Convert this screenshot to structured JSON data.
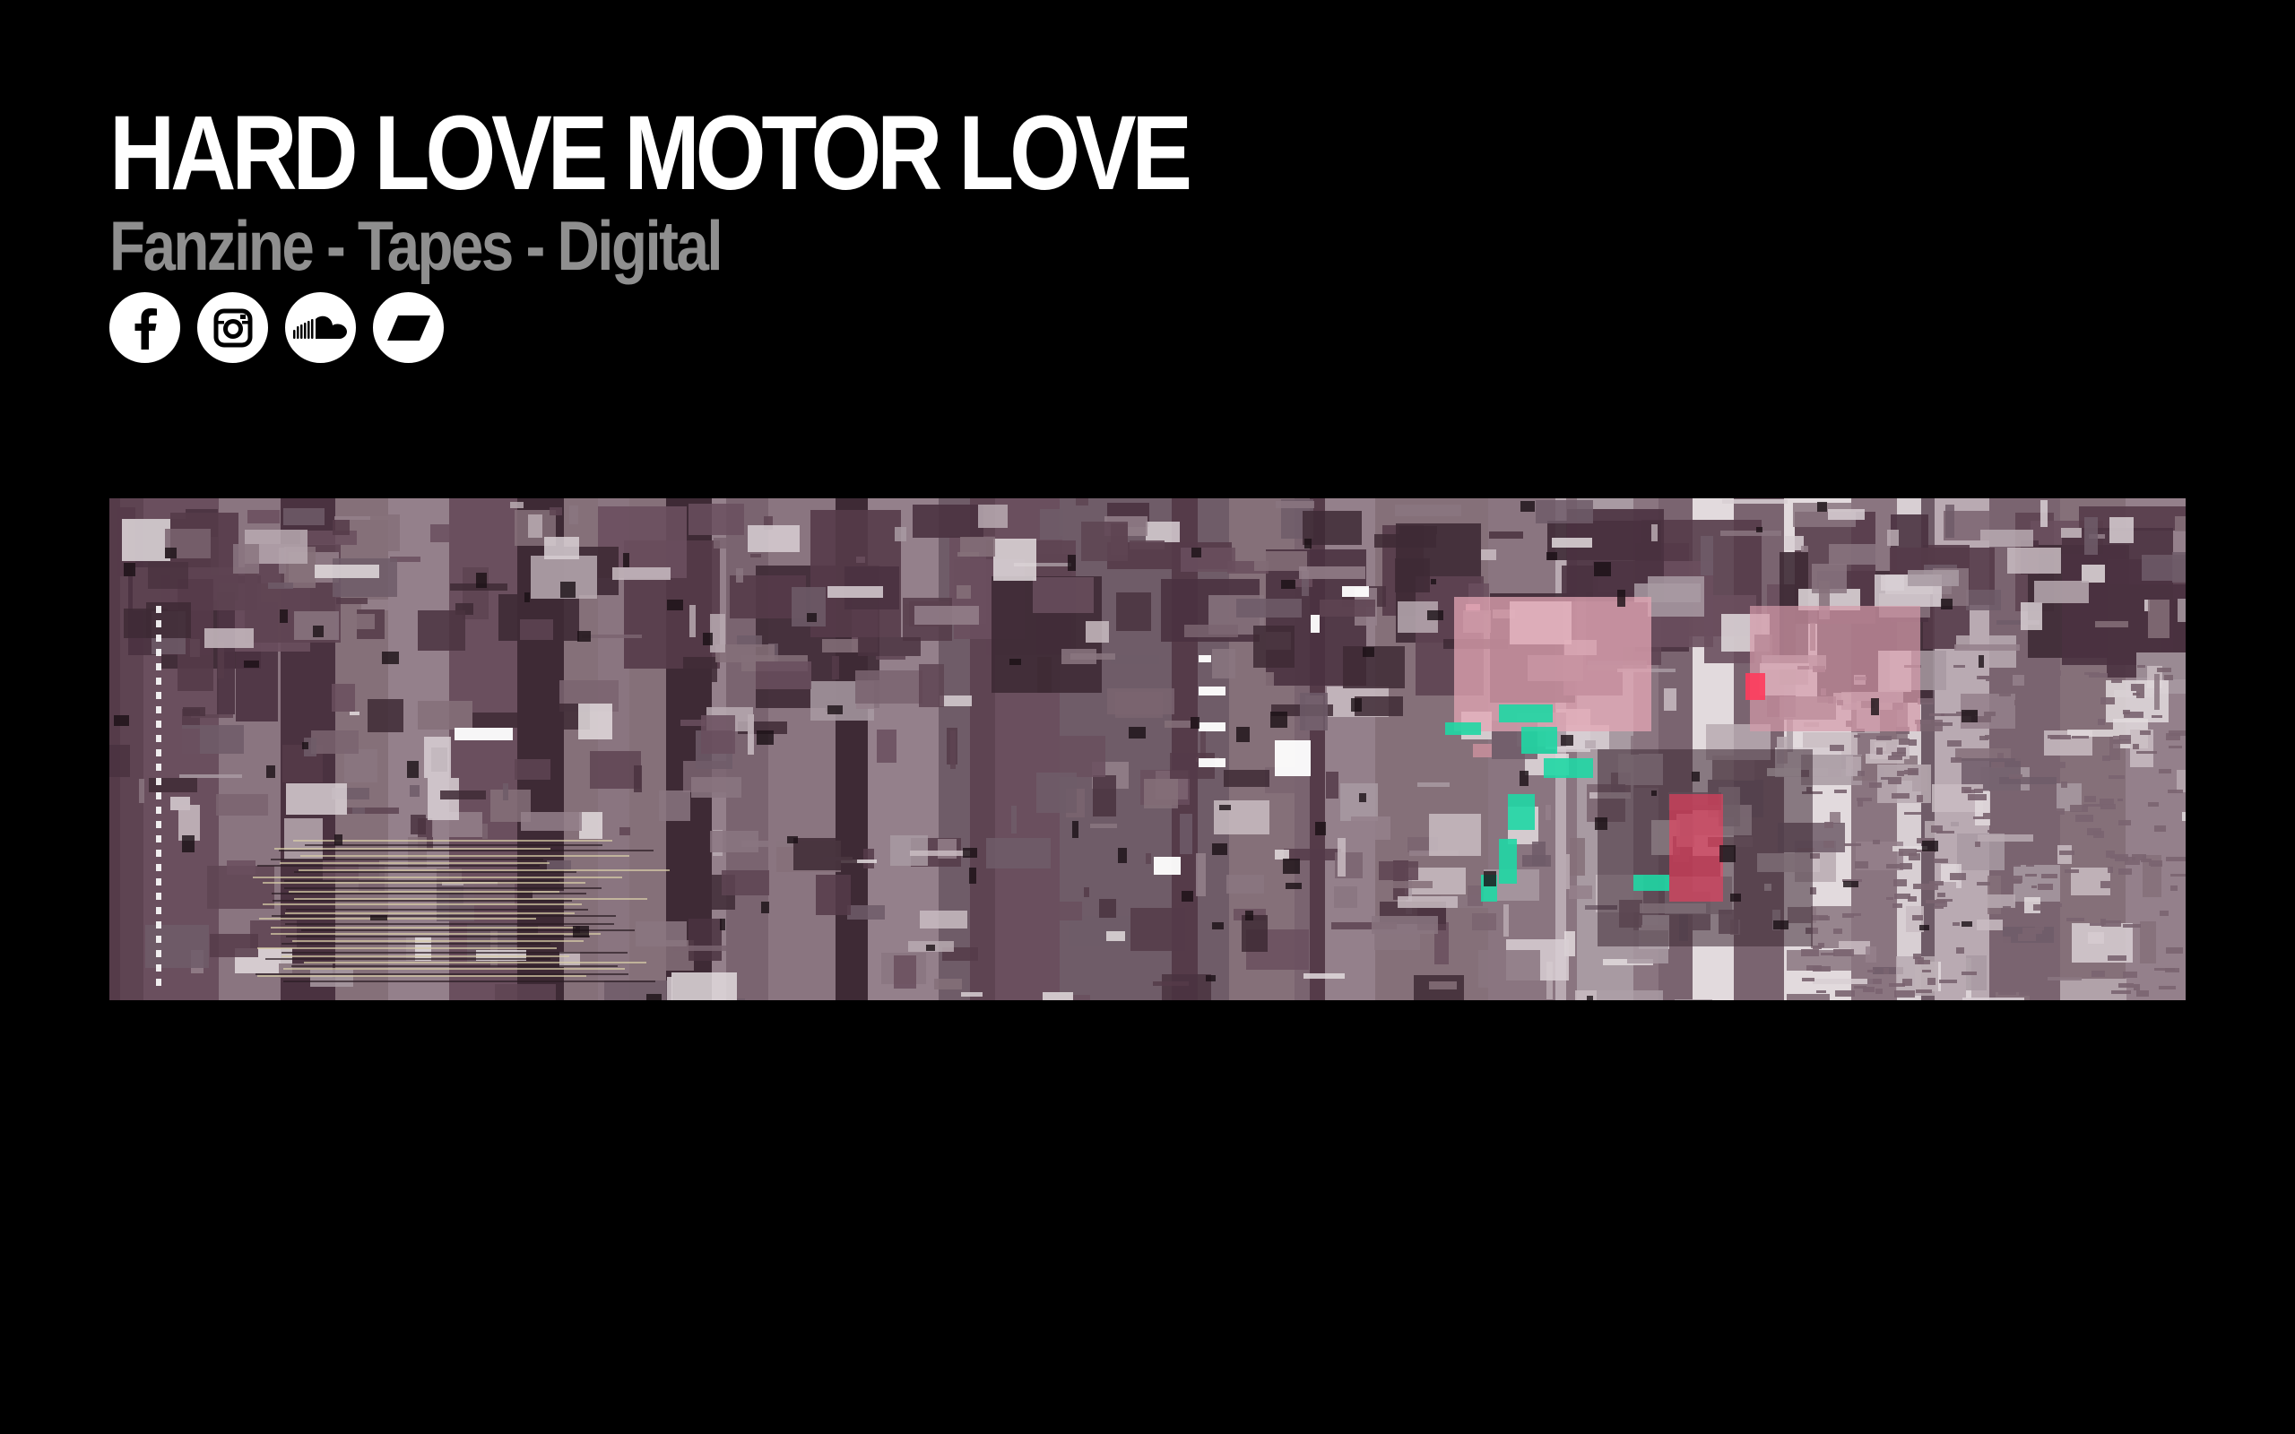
{
  "site": {
    "title": "HARD LOVE MOTOR LOVE",
    "subtitle": "Fanzine - Tapes - Digital"
  },
  "social": [
    {
      "name": "facebook",
      "icon": "facebook-icon"
    },
    {
      "name": "instagram",
      "icon": "instagram-icon"
    },
    {
      "name": "soundcloud",
      "icon": "soundcloud-icon"
    },
    {
      "name": "bandcamp",
      "icon": "bandcamp-icon"
    }
  ],
  "banner": {
    "type": "animated glitch image",
    "colors": {
      "base": "#5a4550",
      "mauve": "#8a7580",
      "light": "#c9bcc2",
      "pink": "#e3a6b4",
      "teal": "#1fd7a4",
      "red": "#ff3b5c"
    }
  },
  "colors": {
    "background": "#000000",
    "title": "#ffffff",
    "subtitle": "#8f8f8f"
  }
}
